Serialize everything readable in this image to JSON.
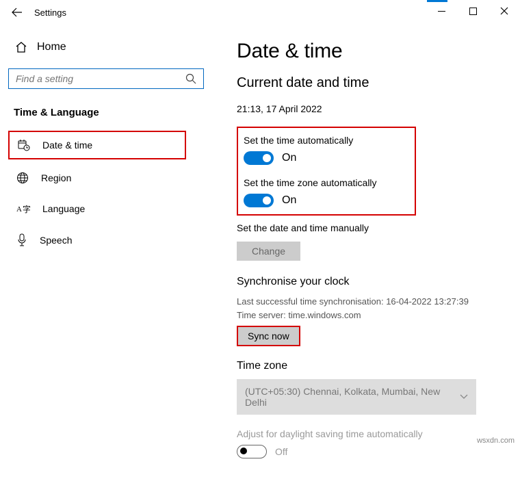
{
  "titlebar": {
    "title": "Settings"
  },
  "sidebar": {
    "home": "Home",
    "search_placeholder": "Find a setting",
    "category": "Time & Language",
    "items": [
      {
        "label": "Date & time"
      },
      {
        "label": "Region"
      },
      {
        "label": "Language"
      },
      {
        "label": "Speech"
      }
    ]
  },
  "main": {
    "heading": "Date & time",
    "subheading": "Current date and time",
    "current_datetime": "21:13, 17 April 2022",
    "auto_time_label": "Set the time automatically",
    "auto_time_state": "On",
    "auto_tz_label": "Set the time zone automatically",
    "auto_tz_state": "On",
    "manual_label": "Set the date and time manually",
    "change_btn": "Change",
    "sync_heading": "Synchronise your clock",
    "sync_last": "Last successful time synchronisation: 16-04-2022 13:27:39",
    "sync_server": "Time server: time.windows.com",
    "sync_btn": "Sync now",
    "tz_heading": "Time zone",
    "tz_value": "(UTC+05:30) Chennai, Kolkata, Mumbai, New Delhi",
    "dst_label": "Adjust for daylight saving time automatically",
    "dst_state": "Off"
  },
  "watermark": "wsxdn.com"
}
